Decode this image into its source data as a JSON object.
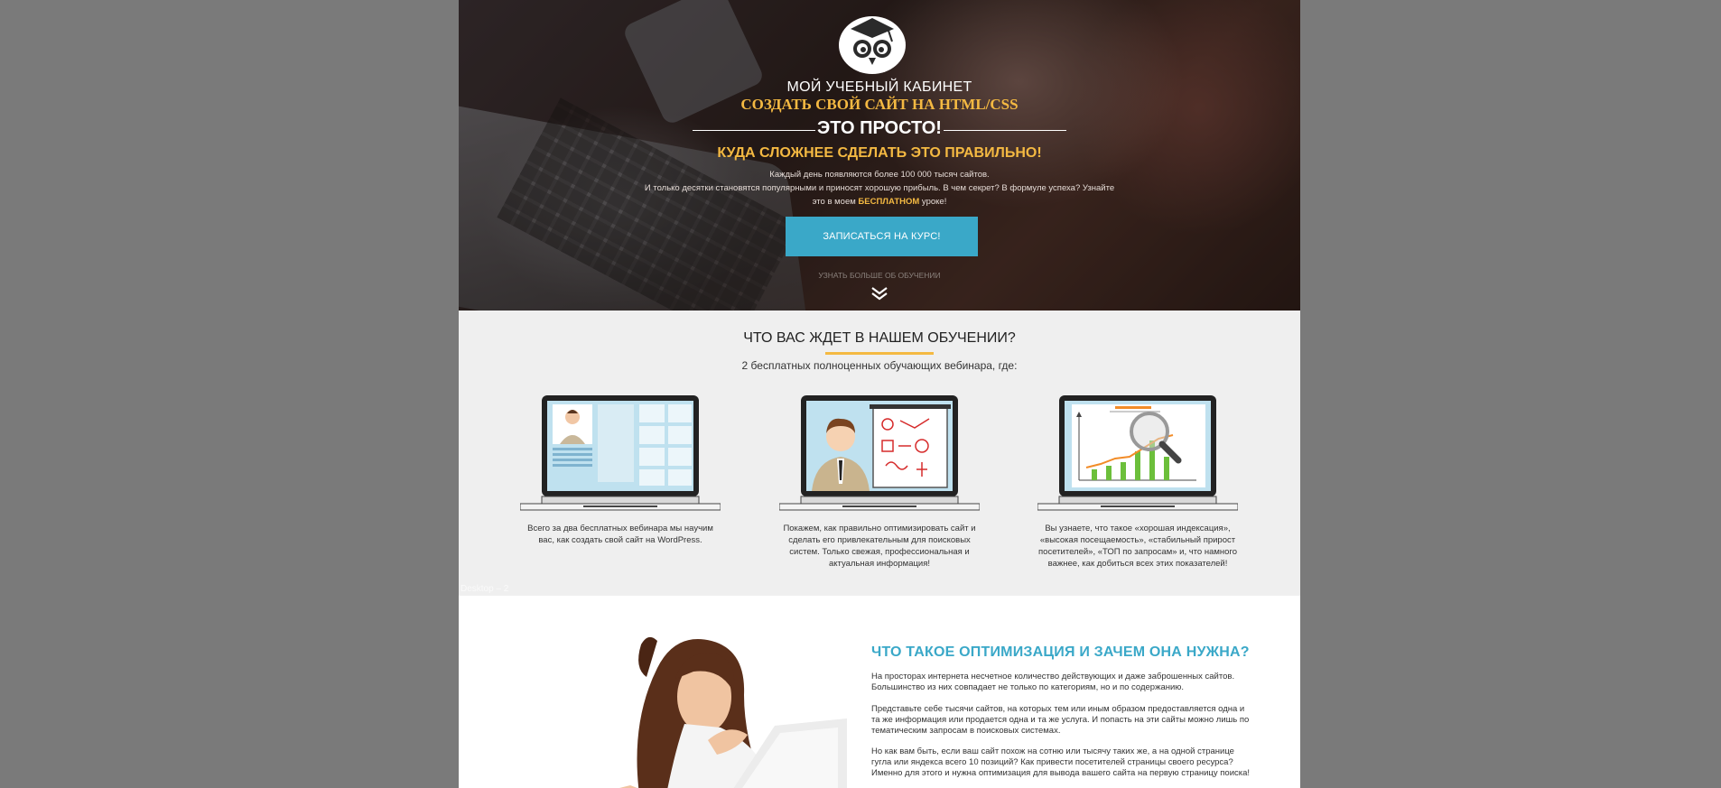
{
  "hero": {
    "cabinet": "МОЙ УЧЕБНЫЙ КАБИНЕТ",
    "course_title": "СОЗДАТЬ СВОЙ САЙТ НА HTML/CSS",
    "easy": "ЭТО ПРОСТО!",
    "harder": "КУДА СЛОЖНЕЕ СДЕЛАТЬ ЭТО ПРАВИЛЬНО!",
    "desc_line1": "Каждый день появляются более 100 000 тысяч сайтов.",
    "desc_line2": "И только десятки становятся популярными и приносят хорошую прибыль. В чем секрет? В формуле успеха? Узнайте",
    "desc_line3_pre": "это в моем ",
    "desc_line3_hl": "БЕСПЛАТНОМ",
    "desc_line3_post": " уроке!",
    "cta_label": "ЗАПИСАТЬСЯ НА КУРС!",
    "more_label": "УЗНАТЬ БОЛЬШЕ ОБ ОБУЧЕНИИ",
    "accent": "#f4b942",
    "button_color": "#3aa8c8"
  },
  "training": {
    "title": "ЧТО ВАС ЖДЕТ В НАШЕМ ОБУЧЕНИИ?",
    "subtitle": "2 бесплатных полноценных обучающих вебинара, где:",
    "cards": [
      {
        "icon": "laptop-website-icon",
        "text": "Всего за два бесплатных вебинара мы научим вас, как создать свой сайт на WordPress."
      },
      {
        "icon": "laptop-presenter-icon",
        "text": "Покажем, как правильно оптимизировать сайт и сделать его привлекательным для поисковых систем. Только свежая, профессиональная и актуальная информация!"
      },
      {
        "icon": "laptop-analytics-icon",
        "text": "Вы узнаете, что такое «хорошая индексация», «высокая посещаемость», «стабильный прирост посетителей», «ТОП по запросам» и, что намного важнее, как добиться всех этих показателей!"
      }
    ],
    "watermark": "Desktop – 2"
  },
  "optimization": {
    "title": "ЧТО ТАКОЕ ОПТИМИЗАЦИЯ И ЗАЧЕМ ОНА НУЖНА?",
    "p1": "На просторах интернета несчетное количество действующих и даже заброшенных сайтов. Большинство из них совпадает не только по категориям, но и по содержанию.",
    "p2": "Представьте себе тысячи сайтов, на которых тем или иным образом предоставляется одна и та же информация или продается одна и та же услуга. И попасть на эти сайты можно лишь по тематическим запросам в поисковых системах.",
    "p3": "Но как вам быть, если ваш сайт похож на сотню или тысячу таких же, а на одной странице гугла или яндекса всего 10 позиций? Как привести посетителей страницы своего ресурса? Именно для этого и нужна оптимизация для вывода вашего сайта на первую страницу поиска!",
    "title_color": "#3aa8c8"
  }
}
